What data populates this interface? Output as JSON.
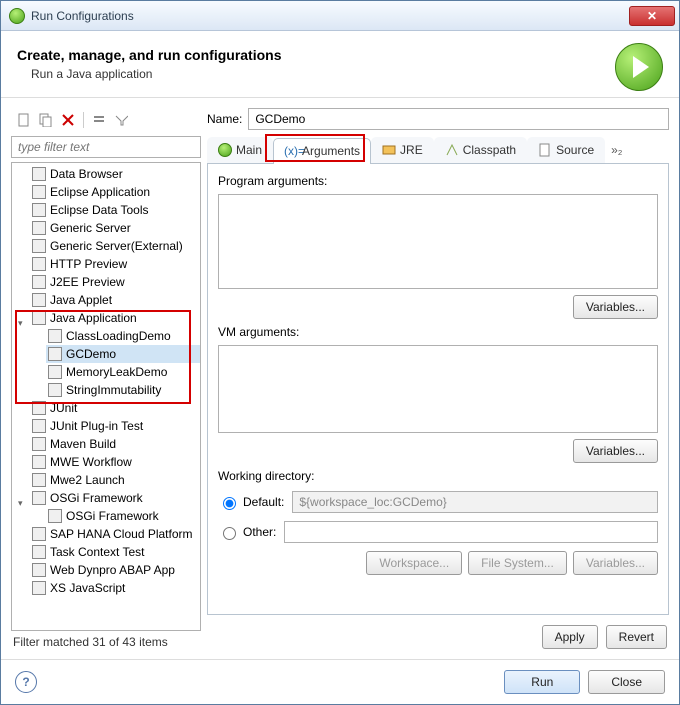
{
  "window": {
    "title": "Run Configurations"
  },
  "header": {
    "title": "Create, manage, and run configurations",
    "subtitle": "Run a Java application"
  },
  "filter": {
    "placeholder": "type filter text"
  },
  "tree": {
    "items": [
      "Data Browser",
      "Eclipse Application",
      "Eclipse Data Tools",
      "Generic Server",
      "Generic Server(External)",
      "HTTP Preview",
      "J2EE Preview",
      "Java Applet"
    ],
    "java_app": {
      "label": "Java Application",
      "children": [
        "ClassLoadingDemo",
        "GCDemo",
        "MemoryLeakDemo",
        "StringImmutability"
      ]
    },
    "after": [
      "JUnit",
      "JUnit Plug-in Test",
      "Maven Build",
      "MWE Workflow",
      "Mwe2 Launch"
    ],
    "osgi": {
      "label": "OSGi Framework",
      "children": [
        "OSGi Framework"
      ]
    },
    "tail": [
      "SAP HANA Cloud Platform",
      "Task Context Test",
      "Web Dynpro ABAP App",
      "XS JavaScript"
    ],
    "selected": "GCDemo"
  },
  "filter_status": "Filter matched 31 of 43 items",
  "form": {
    "name_label": "Name:",
    "name_value": "GCDemo"
  },
  "tabs": {
    "main": "Main",
    "arguments": "Arguments",
    "jre": "JRE",
    "classpath": "Classpath",
    "source": "Source",
    "overflow": "»₂"
  },
  "arguments_pane": {
    "program_label": "Program arguments:",
    "vm_label": "VM arguments:",
    "variables_btn": "Variables...",
    "wd_label": "Working directory:",
    "default_label": "Default:",
    "default_value": "${workspace_loc:GCDemo}",
    "other_label": "Other:",
    "workspace_btn": "Workspace...",
    "filesystem_btn": "File System...",
    "variables2_btn": "Variables..."
  },
  "buttons": {
    "apply": "Apply",
    "revert": "Revert",
    "run": "Run",
    "close": "Close"
  }
}
